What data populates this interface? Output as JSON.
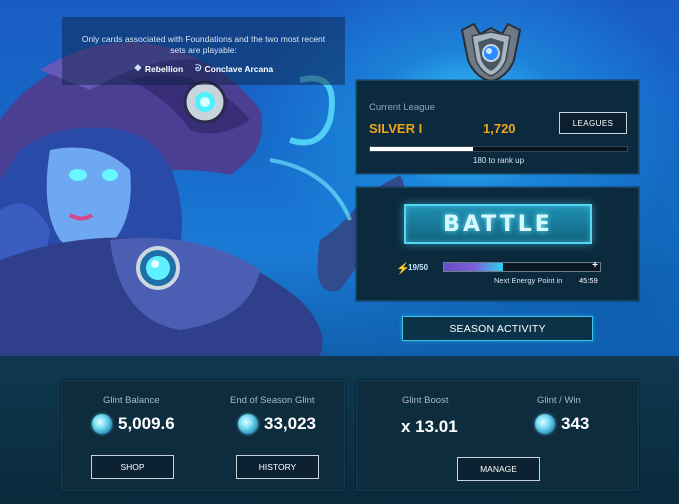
{
  "notice": {
    "text": "Only cards associated with Foundations and the two most recent sets are playable:",
    "sets": [
      {
        "icon": "rebellion-icon",
        "glyph": "❖",
        "name": "Rebellion"
      },
      {
        "icon": "conclave-arcana-icon",
        "glyph": "ᘐ",
        "name": "Conclave Arcana"
      }
    ]
  },
  "league": {
    "label": "Current League",
    "name": "SILVER I",
    "points": "1,720",
    "leagues_button": "LEAGUES",
    "progress_fraction": 0.4,
    "rank_up_text": "180 to rank up"
  },
  "battle": {
    "button_label": "BATTLE",
    "energy": "19/50",
    "energy_fraction": 0.38,
    "plus": "+",
    "next_energy_label": "Next Energy Point in",
    "next_energy_timer": "45:59"
  },
  "season_activity_button": "SEASON ACTIVITY",
  "stats_left": {
    "glint_balance_label": "Glint Balance",
    "glint_balance_value": "5,009.6",
    "end_season_label": "End of Season Glint",
    "end_season_value": "33,023",
    "shop_button": "SHOP",
    "history_button": "HISTORY"
  },
  "stats_right": {
    "glint_boost_label": "Glint Boost",
    "glint_boost_value": "x 13.01",
    "glint_per_win_label": "Glint / Win",
    "glint_per_win_value": "343",
    "manage_button": "MANAGE"
  },
  "colors": {
    "accent_gold": "#f0a51c",
    "battle_glow": "#54d6f4",
    "panel_bg": "#0b2a3e"
  }
}
